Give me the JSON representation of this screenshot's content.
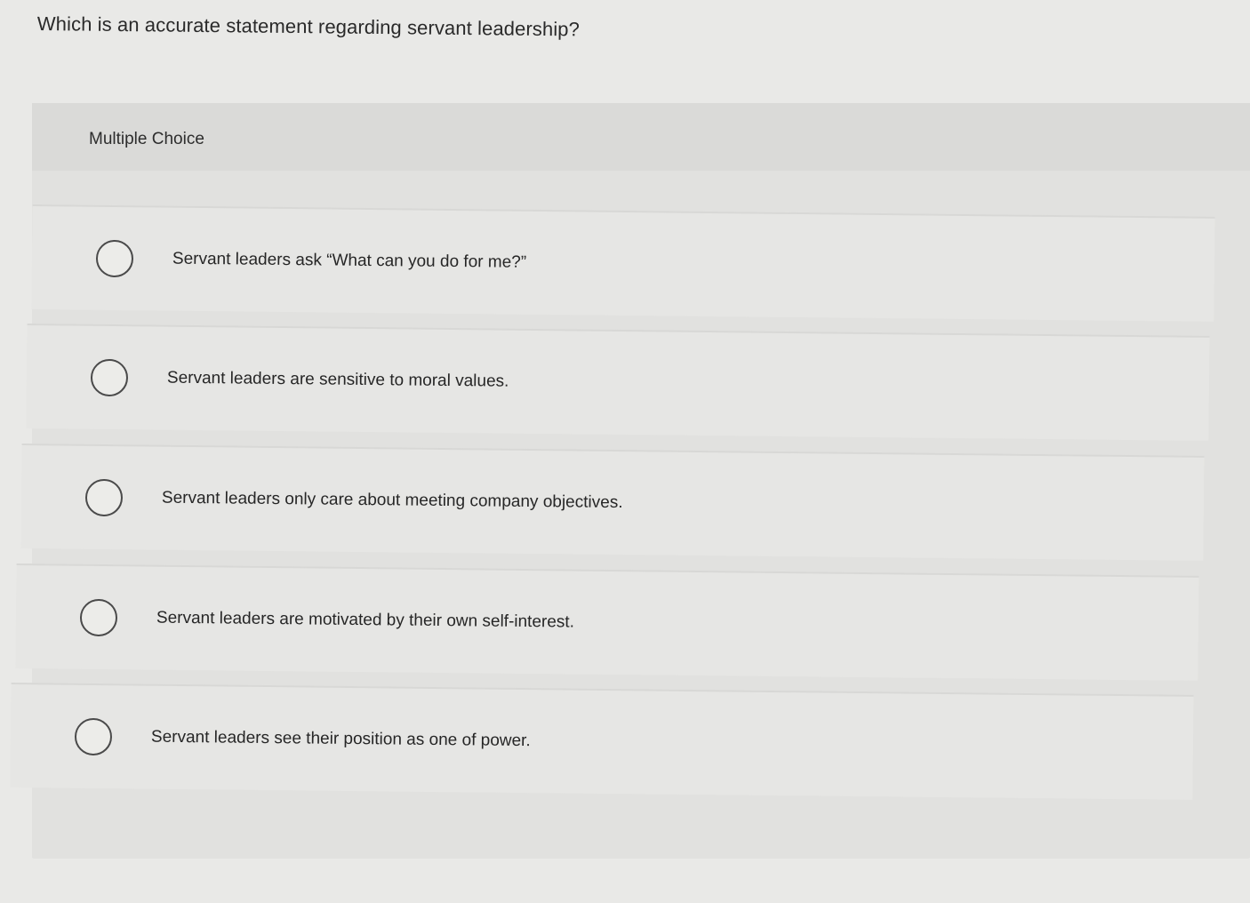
{
  "question": {
    "text": "Which is an accurate statement regarding servant leadership?"
  },
  "panel": {
    "title": "Multiple Choice"
  },
  "options": [
    {
      "label": "Servant leaders ask “What can you do for me?”",
      "selected": false
    },
    {
      "label": "Servant leaders are sensitive to moral values.",
      "selected": false
    },
    {
      "label": "Servant leaders only care about meeting company objectives.",
      "selected": false
    },
    {
      "label": "Servant leaders are motivated by their own self-interest.",
      "selected": false
    },
    {
      "label": "Servant leaders see their position as one of power.",
      "selected": false
    }
  ]
}
